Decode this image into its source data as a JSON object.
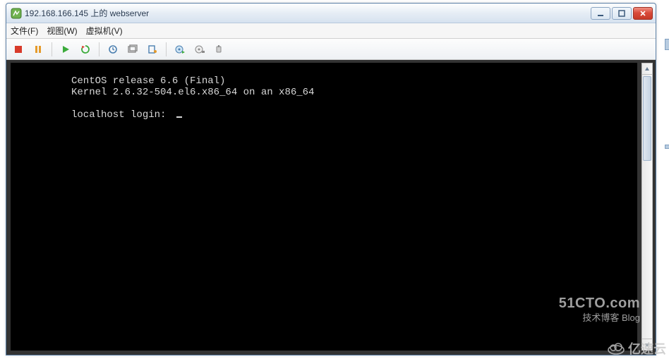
{
  "window": {
    "title": "192.168.166.145 上的 webserver"
  },
  "menu": {
    "file": "文件(F)",
    "view": "视图(W)",
    "vm": "虚拟机(V)"
  },
  "console": {
    "line1": "CentOS release 6.6 (Final)",
    "line2": "Kernel 2.6.32-504.el6.x86_64 on an x86_64",
    "prompt": "localhost login: "
  },
  "watermark": {
    "brand": "51CTO.com",
    "sub": "技术博客  Blog",
    "cloud": "亿速云"
  }
}
